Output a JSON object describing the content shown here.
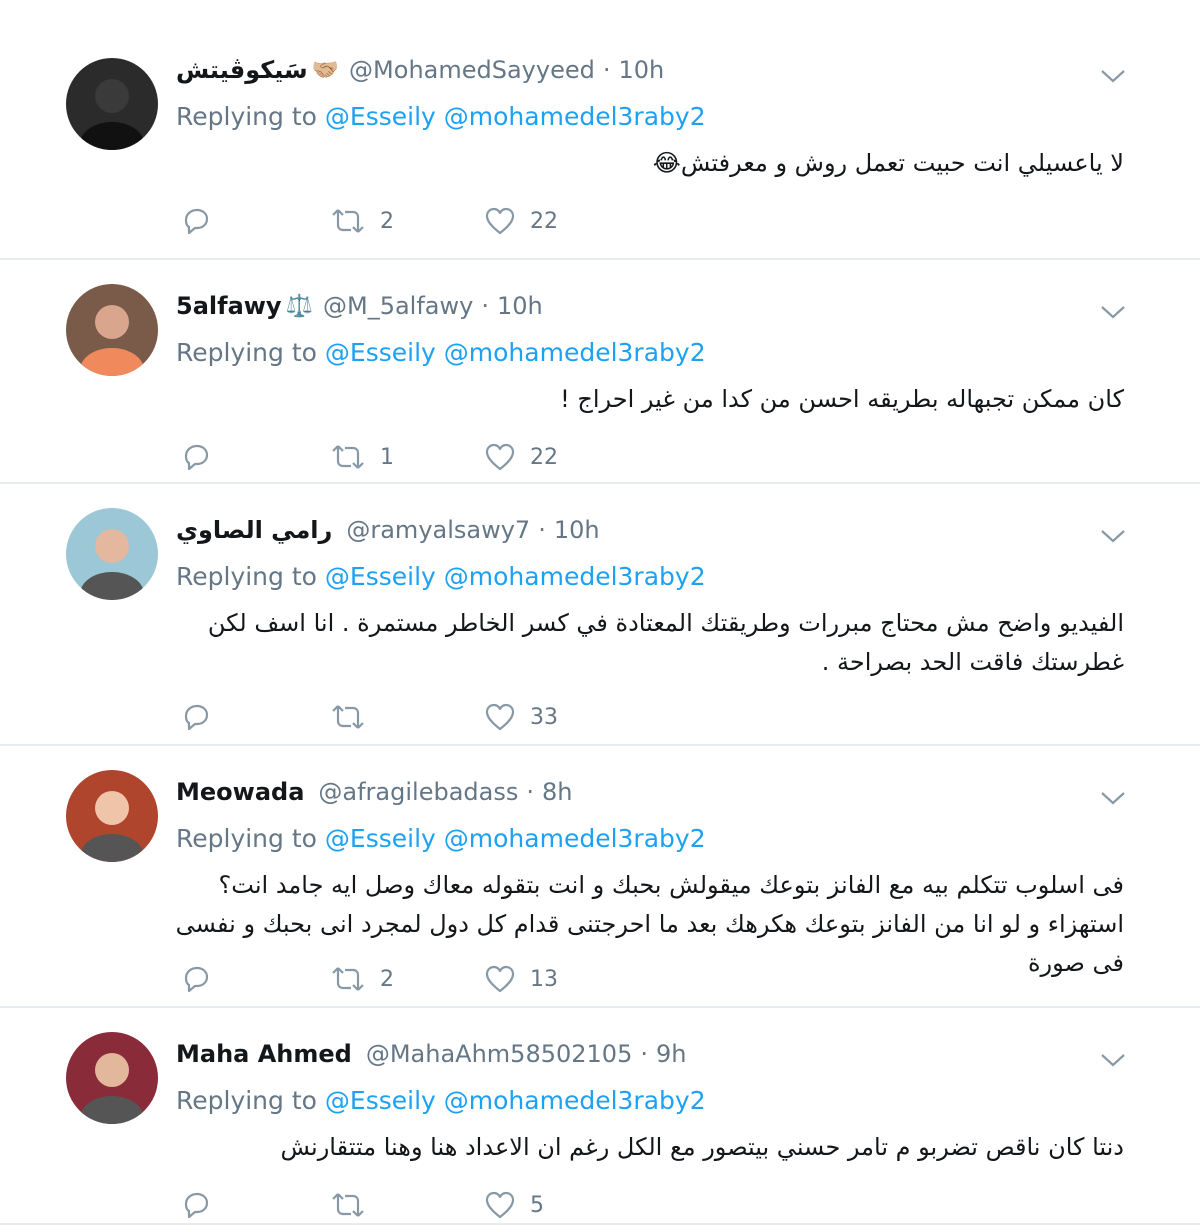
{
  "reply_prefix": "Replying to",
  "tweets": [
    {
      "name": "سَيكوڤيتش",
      "badge": "🤝🏼",
      "handle": "@MohamedSayyeed",
      "time": "10h",
      "mentions": [
        "@Esseily",
        "@mohamedel3raby2"
      ],
      "text": "لا ياعسيلي انت حبيت تعمل روش و معرفتش😂",
      "retweets": "2",
      "likes": "22",
      "avatar_color": "#2b2b2b"
    },
    {
      "name": "5alfawy",
      "badge": "⚖️",
      "handle": "@M_5alfawy",
      "time": "10h",
      "mentions": [
        "@Esseily",
        "@mohamedel3raby2"
      ],
      "text": "كان ممكن تجبهاله بطريقه احسن من كدا من غير احراج !",
      "retweets": "1",
      "likes": "22",
      "avatar_color": "#7a5a48"
    },
    {
      "name": "رامي الصاوي",
      "badge": "",
      "handle": "@ramyalsawy7",
      "time": "10h",
      "mentions": [
        "@Esseily",
        "@mohamedel3raby2"
      ],
      "text": "الفيديو واضح مش محتاج مبررات وطريقتك المعتادة في كسر الخاطر مستمرة . انا اسف لكن غطرستك فاقت الحد بصراحة .",
      "retweets": "",
      "likes": "33",
      "avatar_color": "#9cc7d6"
    },
    {
      "name": "Meowada",
      "badge": "",
      "handle": "@afragilebadass",
      "time": "8h",
      "mentions": [
        "@Esseily",
        "@mohamedel3raby2"
      ],
      "text": "فى اسلوب تتكلم بيه مع الفانز بتوعك ميقولش بحبك و انت بتقوله معاك وصل ايه جامد انت؟ استهزاء و لو انا من الفانز بتوعك هكرهك بعد ما احرجتنى قدام كل دول لمجرد انى بحبك و نفسى فى صورة",
      "retweets": "2",
      "likes": "13",
      "avatar_color": "#b0452e"
    },
    {
      "name": "Maha Ahmed",
      "badge": "",
      "handle": "@MahaAhm58502105",
      "time": "9h",
      "mentions": [
        "@Esseily",
        "@mohamedel3raby2"
      ],
      "text": "دنتا كان ناقص تضربو م تامر حسني بيتصور مع الكل رغم ان الاعداد هنا وهنا متتقارنش",
      "retweets": "",
      "likes": "5",
      "avatar_color": "#8a2b3a"
    }
  ]
}
